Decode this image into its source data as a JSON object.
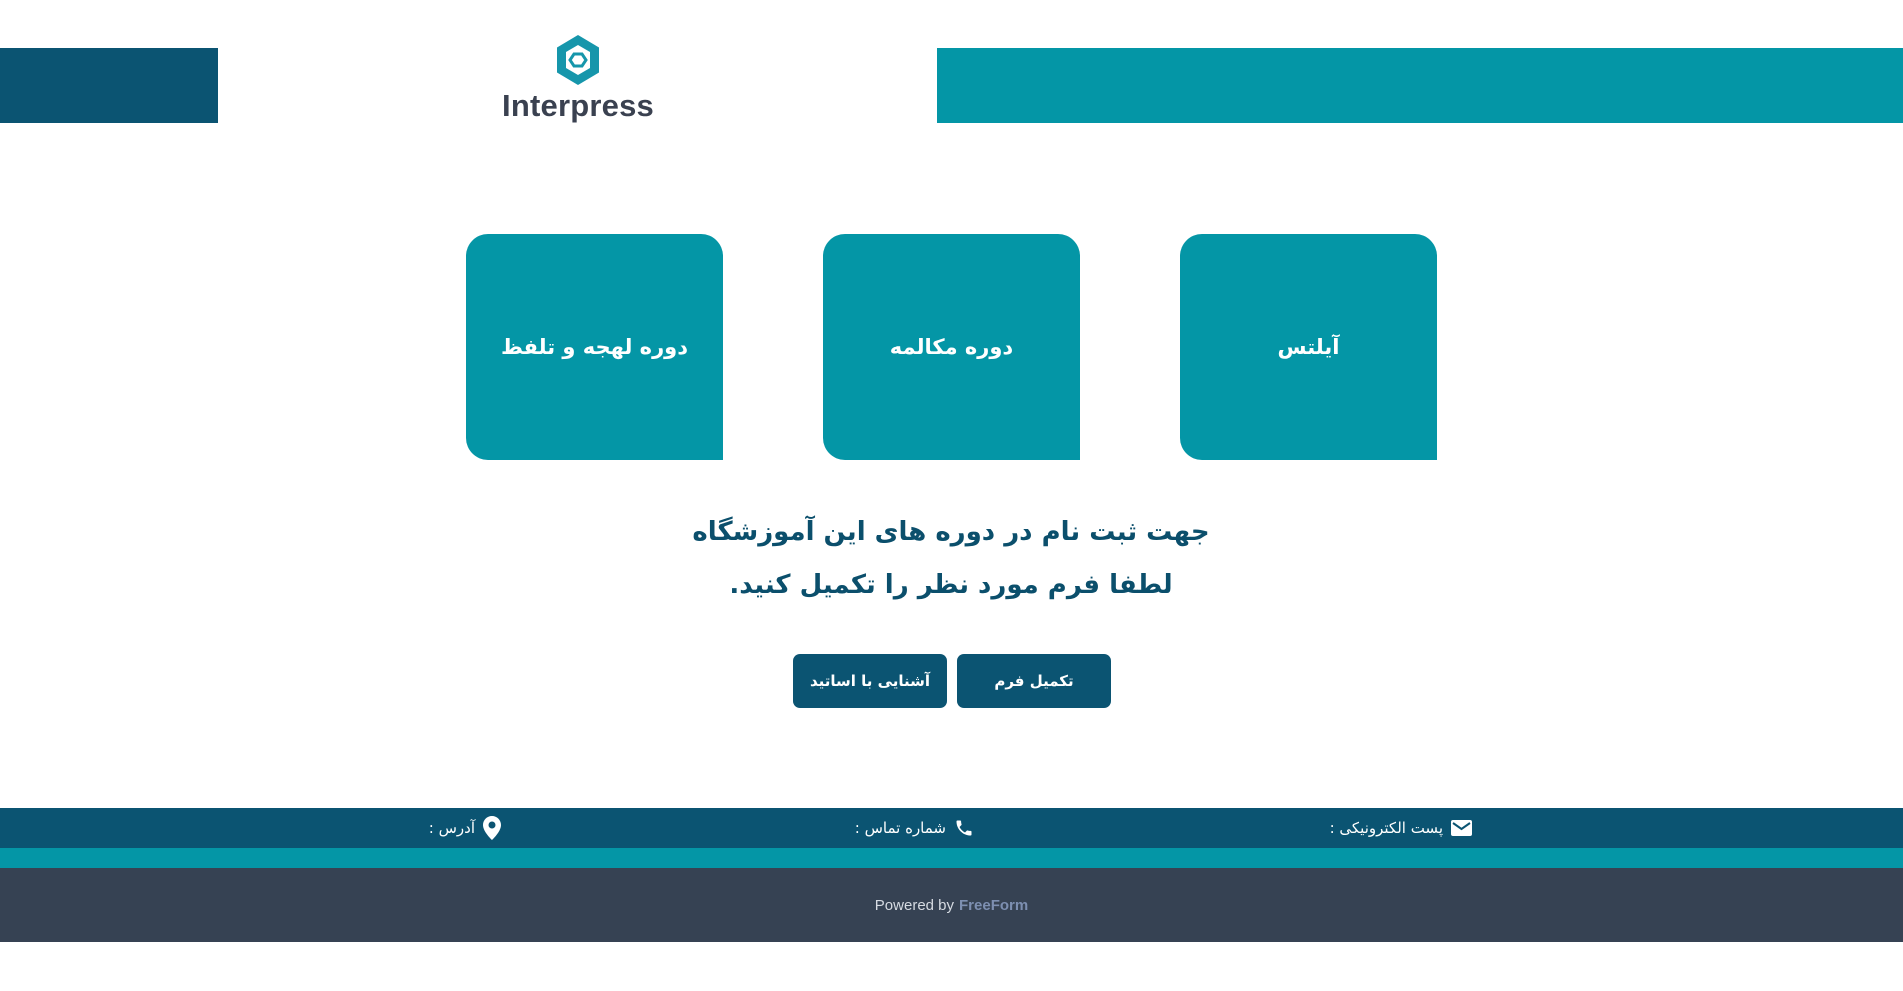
{
  "header": {
    "logo_text": "Interpress",
    "colors": {
      "dark": "#0b5472",
      "teal": "#0496a6",
      "footer": "#364253"
    }
  },
  "courses": [
    {
      "label": "آیلتس"
    },
    {
      "label": "دوره مکالمه"
    },
    {
      "label": "دوره لهجه و تلفظ"
    }
  ],
  "headline": {
    "line1": "جهت ثبت نام در دوره های این آموزشگاه",
    "line2": "لطفا فرم مورد نظر را تکمیل کنید."
  },
  "buttons": {
    "fill_form": "تکمیل فرم",
    "meet_teachers": "آشنایی با اساتید"
  },
  "contact": {
    "email_label": "پست الکترونیکی :",
    "phone_label": "شماره تماس :",
    "address_label": "آدرس :",
    "icons": [
      "mail-icon",
      "phone-icon",
      "location-pin-icon"
    ]
  },
  "footer": {
    "powered_by": "Powered by",
    "brand": "FreeForm"
  }
}
